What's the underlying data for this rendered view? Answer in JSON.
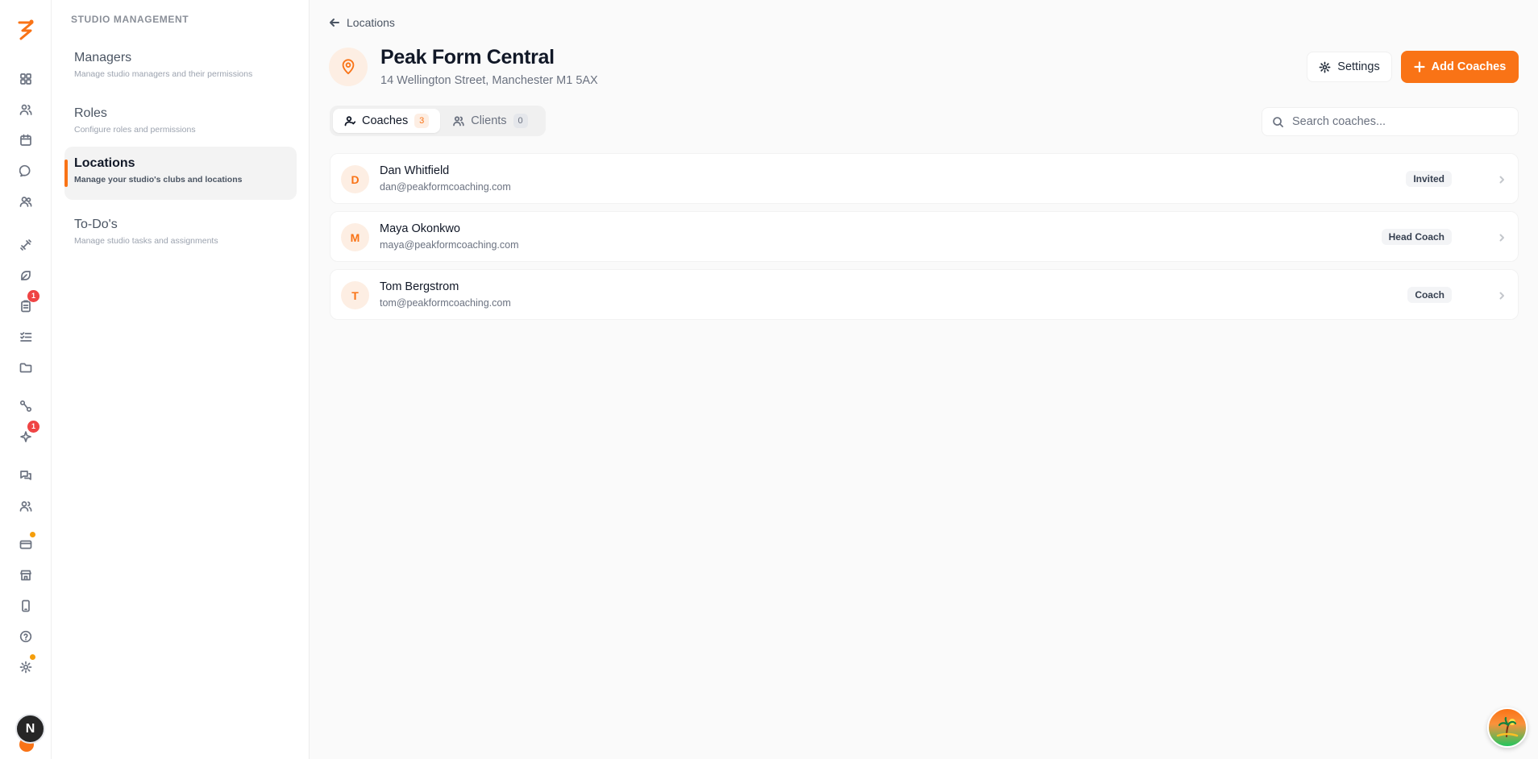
{
  "subnav": {
    "section_title": "STUDIO MANAGEMENT",
    "items": [
      {
        "title": "Managers",
        "desc": "Manage studio managers and their permissions"
      },
      {
        "title": "Roles",
        "desc": "Configure roles and permissions"
      },
      {
        "title": "Locations",
        "desc": "Manage your studio's clubs and locations"
      },
      {
        "title": "To-Do's",
        "desc": "Manage studio tasks and assignments"
      }
    ]
  },
  "rail": {
    "badges": {
      "tasks": "1",
      "sparkle": "1"
    },
    "avatar_initial": "N"
  },
  "header": {
    "breadcrumb": "Locations",
    "title": "Peak Form Central",
    "address": "14 Wellington Street, Manchester M1 5AX",
    "settings_label": "Settings",
    "add_label": "Add Coaches"
  },
  "tabs": [
    {
      "label": "Coaches",
      "count": "3"
    },
    {
      "label": "Clients",
      "count": "0"
    }
  ],
  "search": {
    "placeholder": "Search coaches..."
  },
  "coaches": [
    {
      "initial": "D",
      "name": "Dan Whitfield",
      "email": "dan@peakformcoaching.com",
      "role": "Invited"
    },
    {
      "initial": "M",
      "name": "Maya Okonkwo",
      "email": "maya@peakformcoaching.com",
      "role": "Head Coach"
    },
    {
      "initial": "T",
      "name": "Tom Bergstrom",
      "email": "tom@peakformcoaching.com",
      "role": "Coach"
    }
  ],
  "colors": {
    "accent": "#f97316",
    "badge": "#ef4444",
    "notice": "#f59e0b"
  }
}
